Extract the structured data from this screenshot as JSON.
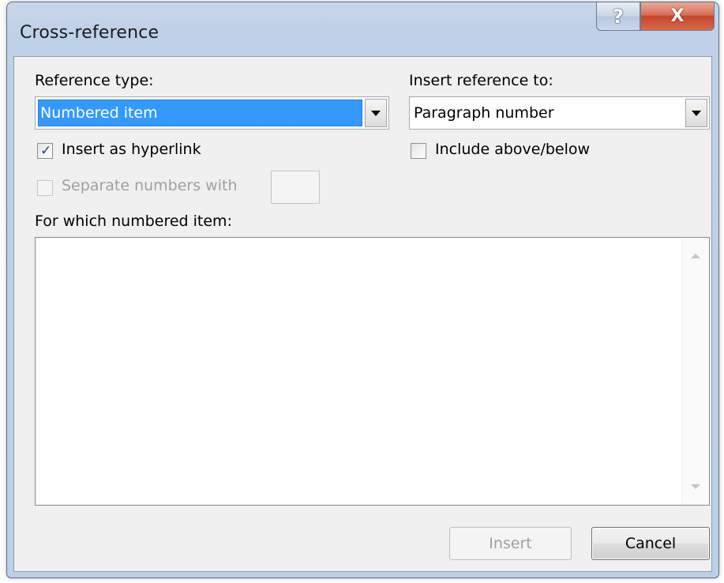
{
  "window": {
    "title": "Cross-reference",
    "help_glyph": "?",
    "close_glyph": "X"
  },
  "reference_type": {
    "label": "Reference type:",
    "selected_value": "Numbered item"
  },
  "insert_reference_to": {
    "label": "Insert reference to:",
    "selected_value": "Paragraph number"
  },
  "insert_as_hyperlink": {
    "label": "Insert as hyperlink",
    "checked": true,
    "check_glyph": "✓"
  },
  "include_above_below": {
    "label": "Include above/below",
    "checked": false
  },
  "separate_numbers": {
    "label": "Separate numbers with",
    "checked": false,
    "enabled": false,
    "value": ""
  },
  "for_which": {
    "label": "For which numbered item:",
    "items": []
  },
  "buttons": {
    "insert_label": "Insert",
    "cancel_label": "Cancel"
  },
  "icons": {
    "help": "help-icon",
    "close": "close-icon",
    "dropdown": "chevron-down-icon",
    "scroll_up": "scroll-up-icon",
    "scroll_down": "scroll-down-icon"
  },
  "colors": {
    "selection": "#3399ff",
    "close_button": "#c7442a",
    "window_frame": "#bcd0e8",
    "client_bg": "#f0f0f0"
  }
}
